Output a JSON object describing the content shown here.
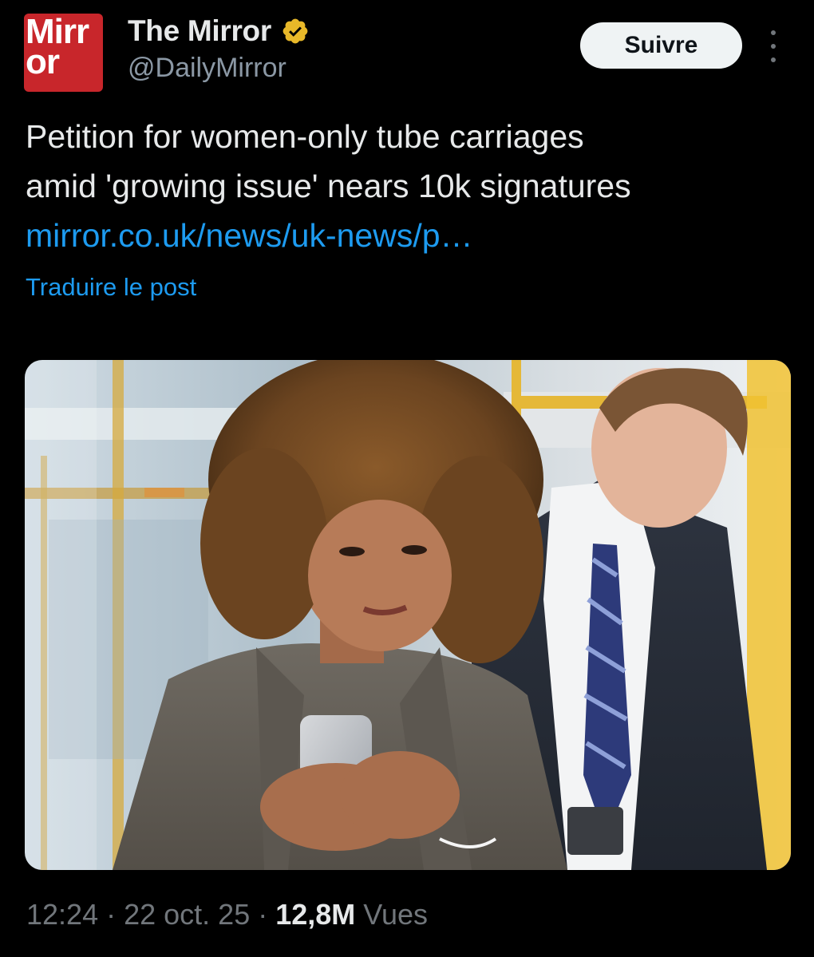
{
  "author": {
    "avatar_text": "Mirr\nor",
    "display_name": "The Mirror",
    "handle": "@DailyMirror",
    "verified_icon": "verified-gold-badge-icon",
    "avatar_color": "#c8262b",
    "badge_color": "#e8b829"
  },
  "header": {
    "follow_label": "Suivre",
    "more_icon": "more-vertical-icon"
  },
  "post": {
    "text_line_1": "Petition for women-only tube carriages",
    "text_line_2": "amid 'growing issue' nears 10k signatures",
    "link_text": "mirror.co.uk/news/uk-news/p…",
    "translate_label": "Traduire le post",
    "link_color": "#1d9bf0"
  },
  "media": {
    "image_icon": "photo-woman-man-train-image"
  },
  "meta": {
    "time": "12:24",
    "separator": "·",
    "date": "22 oct. 25",
    "views_count": "12,8M",
    "views_label": "Vues"
  }
}
